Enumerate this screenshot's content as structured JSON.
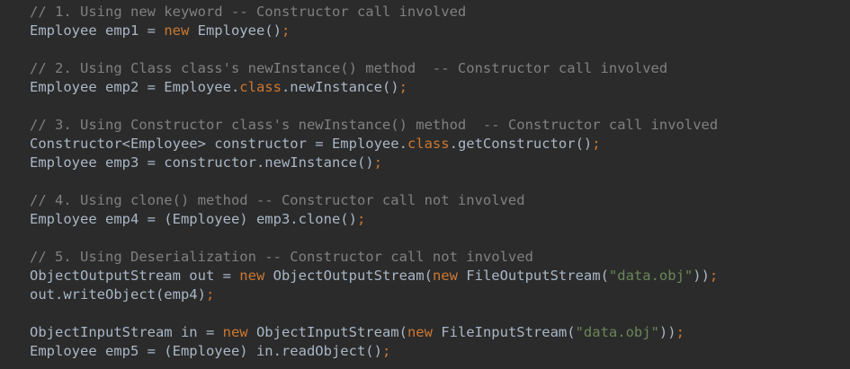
{
  "editor": {
    "colors": {
      "background": "#2b2b2b",
      "plain": "#a9b7c6",
      "comment": "#808080",
      "keyword": "#cc7832",
      "string": "#6a8759"
    },
    "lines": [
      [
        {
          "t": "// 1. Using new keyword -- Constructor call involved",
          "c": "comment"
        }
      ],
      [
        {
          "t": "Employee emp1 = ",
          "c": "plain"
        },
        {
          "t": "new",
          "c": "keyword"
        },
        {
          "t": " Employee()",
          "c": "plain"
        },
        {
          "t": ";",
          "c": "keyword"
        }
      ],
      [],
      [
        {
          "t": "// 2. Using Class class's newInstance() method  -- Constructor call involved",
          "c": "comment"
        }
      ],
      [
        {
          "t": "Employee emp2 = Employee.",
          "c": "plain"
        },
        {
          "t": "class",
          "c": "keyword"
        },
        {
          "t": ".newInstance()",
          "c": "plain"
        },
        {
          "t": ";",
          "c": "keyword"
        }
      ],
      [],
      [
        {
          "t": "// 3. Using Constructor class's newInstance() method  -- Constructor call involved",
          "c": "comment"
        }
      ],
      [
        {
          "t": "Constructor<Employee> constructor = Employee.",
          "c": "plain"
        },
        {
          "t": "class",
          "c": "keyword"
        },
        {
          "t": ".getConstructor()",
          "c": "plain"
        },
        {
          "t": ";",
          "c": "keyword"
        }
      ],
      [
        {
          "t": "Employee emp3 = constructor.newInstance()",
          "c": "plain"
        },
        {
          "t": ";",
          "c": "keyword"
        }
      ],
      [],
      [
        {
          "t": "// 4. Using clone() method -- Constructor call not involved",
          "c": "comment"
        }
      ],
      [
        {
          "t": "Employee emp4 = (Employee) emp3.clone()",
          "c": "plain"
        },
        {
          "t": ";",
          "c": "keyword"
        }
      ],
      [],
      [
        {
          "t": "// 5. Using Deserialization -- Constructor call not involved",
          "c": "comment"
        }
      ],
      [
        {
          "t": "ObjectOutputStream out = ",
          "c": "plain"
        },
        {
          "t": "new",
          "c": "keyword"
        },
        {
          "t": " ObjectOutputStream(",
          "c": "plain"
        },
        {
          "t": "new",
          "c": "keyword"
        },
        {
          "t": " FileOutputStream(",
          "c": "plain"
        },
        {
          "t": "\"data.obj\"",
          "c": "string"
        },
        {
          "t": "))",
          "c": "plain"
        },
        {
          "t": ";",
          "c": "keyword"
        }
      ],
      [
        {
          "t": "out.writeObject(emp4)",
          "c": "plain"
        },
        {
          "t": ";",
          "c": "keyword"
        }
      ],
      [],
      [
        {
          "t": "ObjectInputStream in = ",
          "c": "plain"
        },
        {
          "t": "new",
          "c": "keyword"
        },
        {
          "t": " ObjectInputStream(",
          "c": "plain"
        },
        {
          "t": "new",
          "c": "keyword"
        },
        {
          "t": " FileInputStream(",
          "c": "plain"
        },
        {
          "t": "\"data.obj\"",
          "c": "string"
        },
        {
          "t": "))",
          "c": "plain"
        },
        {
          "t": ";",
          "c": "keyword"
        }
      ],
      [
        {
          "t": "Employee emp5 = (Employee) in.readObject()",
          "c": "plain"
        },
        {
          "t": ";",
          "c": "keyword"
        }
      ]
    ]
  }
}
